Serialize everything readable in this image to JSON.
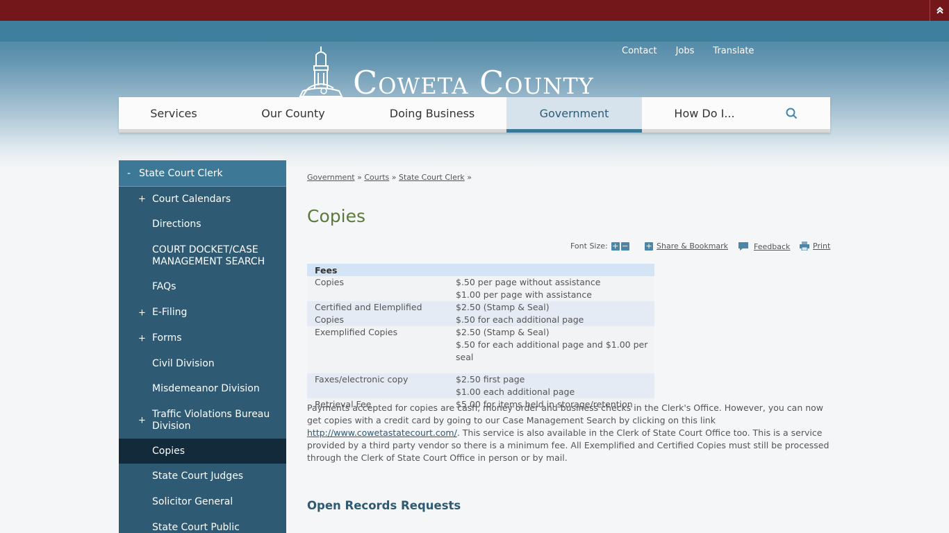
{
  "header": {
    "utility_links": [
      "Contact",
      "Jobs",
      "Translate"
    ],
    "logo_text": "Coweta County"
  },
  "nav": {
    "items": [
      {
        "label": "Services"
      },
      {
        "label": "Our County"
      },
      {
        "label": "Doing Business"
      },
      {
        "label": "Government",
        "active": true
      },
      {
        "label": "How Do I..."
      }
    ],
    "search_icon": "search-icon"
  },
  "sidebar": {
    "title": "State Court Clerk",
    "toggle": "-",
    "items": [
      {
        "label": "Court Calendars",
        "expandable": "+"
      },
      {
        "label": "Directions"
      },
      {
        "label": "COURT DOCKET/CASE MANAGEMENT SEARCH"
      },
      {
        "label": "FAQs"
      },
      {
        "label": "E-Filing",
        "expandable": "+"
      },
      {
        "label": "Forms",
        "expandable": "+"
      },
      {
        "label": "Civil Division"
      },
      {
        "label": "Misdemeanor Division"
      },
      {
        "label": "Traffic Violations Bureau Division",
        "expandable": "+"
      },
      {
        "label": "Copies",
        "current": true
      },
      {
        "label": "State Court Judges"
      },
      {
        "label": "Solicitor General"
      },
      {
        "label": "State Court Public"
      }
    ]
  },
  "breadcrumb": {
    "items": [
      "Government",
      "Courts",
      "State Court Clerk"
    ],
    "separator": "»"
  },
  "page": {
    "title": "Copies"
  },
  "tools": {
    "font_size_label": "Font Size:",
    "share": "Share & Bookmark",
    "feedback": "Feedback",
    "print": "Print"
  },
  "fees": {
    "header": "Fees",
    "rows": [
      {
        "item": "Copies",
        "lines": [
          "$.50 per page without assistance",
          "$1.00 per page with assistance"
        ]
      },
      {
        "item": "Certified and Elemplified Copies",
        "lines": [
          "$2.50 (Stamp & Seal)",
          "$.50 for each additional page"
        ]
      },
      {
        "item": "Exemplified Copies",
        "lines": [
          "$2.50 (Stamp & Seal)",
          "$.50 for each additional page and $1.00 per seal",
          ""
        ]
      },
      {
        "item": "Faxes/electronic copy",
        "lines": [
          "$2.50 first page",
          "$1.00 each additional page"
        ]
      },
      {
        "item": "Retrieval Fee",
        "lines": [
          "$5.00 for items held in storage/retention"
        ]
      }
    ]
  },
  "payment": {
    "text_before": "Payments accepted for copies are cash, money order and business checks in the Clerk's Office.  However, you can now get copies with a credit card by going to our Case Management Search by clicking on this link ",
    "link": "http://www.cowetastatecourt.com/",
    "text_after": ".  This service is also available in the Clerk of State Court Office too.  This is a service provided by a third party vendor so there is a minimum fee.  All Exemplified and Certified Copies must still be processed through the Clerk of State Court Office in person or by mail."
  },
  "section": {
    "heading": "Open Records Requests"
  },
  "colors": {
    "top_bar": "#74171a",
    "header_blue": "#3f7f9e",
    "sidebar": "#2f5a73",
    "sidebar_current": "#122a3a",
    "title_green": "#5b7a3a",
    "table_header": "#d2e4f5"
  }
}
